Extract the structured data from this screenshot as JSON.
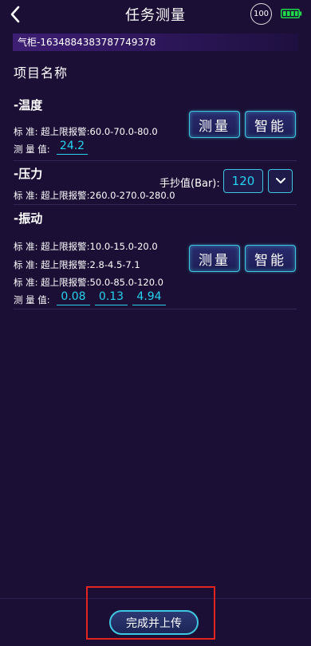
{
  "header": {
    "title": "任务测量",
    "timer_value": "100",
    "icons": [
      "chevron-left-icon",
      "timer-icon",
      "battery-icon"
    ]
  },
  "device": {
    "name": "气柜-1634884383787749378"
  },
  "section": {
    "title": "项目名称"
  },
  "temperature": {
    "title": "-温度",
    "standard": "标 准: 超上限报警:60.0-70.0-80.0",
    "measure_label": "测 量 值:",
    "value": "24.2",
    "measure_btn": "测量",
    "smart_btn": "智能"
  },
  "pressure": {
    "title": "-压力",
    "standard": "标 准: 超上限报警:260.0-270.0-280.0",
    "manual_label": "手抄值(Bar):",
    "manual_value": "120"
  },
  "vibration": {
    "title": "-振动",
    "standards": [
      "标 准: 超上限报警:10.0-15.0-20.0",
      "标 准: 超上限报警:2.8-4.5-7.1",
      "标 准: 超上限报警:50.0-85.0-120.0"
    ],
    "measure_label": "测 量 值:",
    "values": [
      "0.08",
      "0.13",
      "4.94"
    ],
    "measure_btn": "测量",
    "smart_btn": "智能"
  },
  "footer": {
    "submit_label": "完成并上传"
  },
  "colors": {
    "background": "#1b0f35",
    "accent": "#3ec7e0",
    "value": "#25d3ef",
    "battery": "#21d84b",
    "highlight": "#e3231d"
  }
}
